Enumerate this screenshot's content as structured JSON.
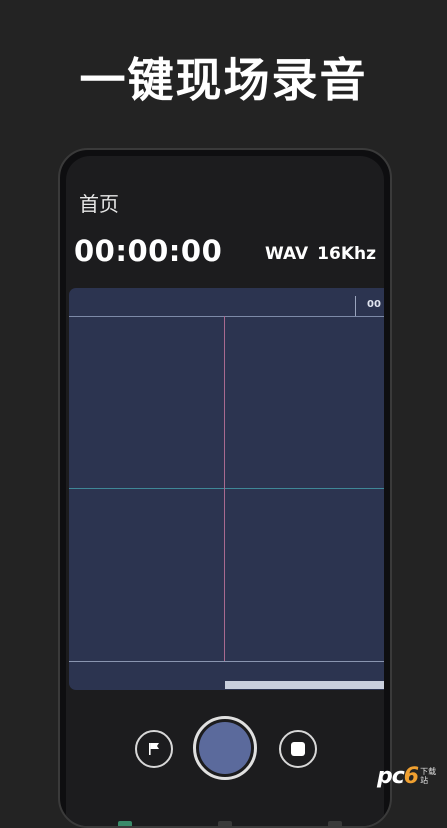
{
  "headline": "一键现场录音",
  "app": {
    "title": "首页",
    "timer": "00:00:00",
    "format": "WAV",
    "sample_rate": "16Khz"
  },
  "waveform": {
    "ruler_label": "00"
  },
  "controls": {
    "flag_icon": "flag-icon",
    "record_icon": "record-icon",
    "stop_icon": "stop-icon"
  },
  "watermark": {
    "logo_prefix": "pc",
    "logo_digit": "6",
    "sub": "下载站"
  },
  "colors": {
    "background": "#232323",
    "wave_bg": "#2c3450",
    "record_fill": "#5b6a9c",
    "center_line_h": "#3f8797",
    "center_line_v": "#a86a8f"
  }
}
